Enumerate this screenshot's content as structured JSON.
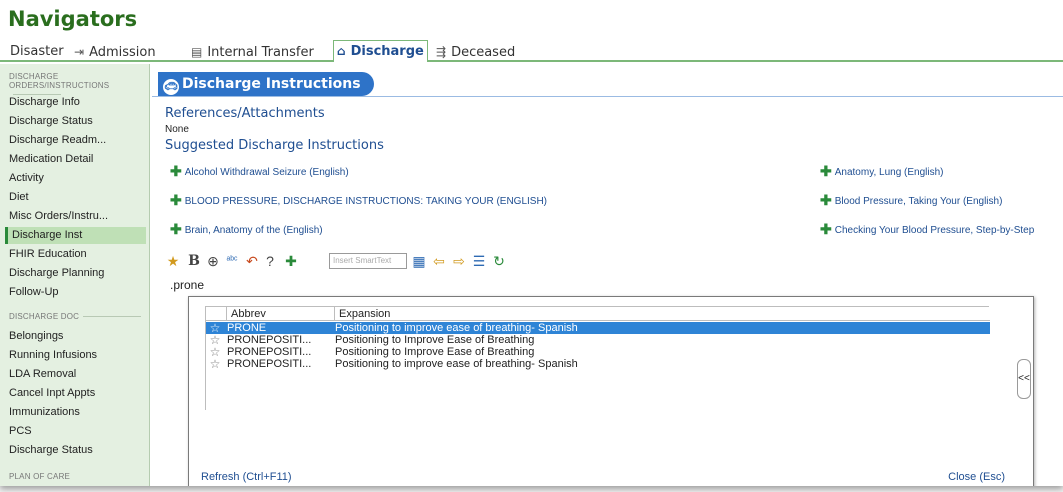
{
  "title": "Navigators",
  "tabs": [
    {
      "label": "Disaster",
      "icon": "exit-icon"
    },
    {
      "label": "Admission",
      "icon": "document-icon"
    },
    {
      "label": "Internal Transfer",
      "icon": "home-icon"
    },
    {
      "label": "Discharge",
      "icon": "deceased-icon",
      "active": true
    },
    {
      "label": "Deceased",
      "icon": ""
    }
  ],
  "sidebar": {
    "section1_header_line1": "Discharge",
    "section1_header_line2": "Orders/Instructions",
    "items1": [
      "Discharge Info",
      "Discharge Status",
      "Discharge Readm...",
      "Medication Detail",
      "Activity",
      "Diet",
      "Misc Orders/Instru...",
      "Discharge Inst",
      "FHIR Education",
      "Discharge Planning",
      "Follow-Up"
    ],
    "selected_item": "Discharge Inst",
    "section2_header": "Discharge Doc",
    "items2": [
      "Belongings",
      "Running Infusions",
      "LDA Removal",
      "Cancel Inpt Appts",
      "Immunizations",
      "PCS",
      "Discharge Status"
    ],
    "section3_header": "Plan of Care"
  },
  "main": {
    "section_title": "Discharge Instructions",
    "references_heading": "References/Attachments",
    "references_value": "None",
    "suggested_heading": "Suggested Discharge Instructions",
    "instructions_left": [
      "Alcohol Withdrawal Seizure (English)",
      "BLOOD PRESSURE, DISCHARGE INSTRUCTIONS: TAKING YOUR (ENGLISH)",
      "Brain, Anatomy of the (English)"
    ],
    "instructions_right": [
      "Anatomy, Lung (English)",
      "Blood Pressure, Taking Your (English)",
      "Checking Your Blood Pressure, Step-by-Step"
    ],
    "smarttext_placeholder": "Insert SmartText",
    "editor_text": ".prone"
  },
  "picker": {
    "col_abbrev": "Abbrev",
    "col_expansion": "Expansion",
    "rows": [
      {
        "abbrev": "PRONE",
        "expansion": "Positioning to improve ease of breathing- Spanish",
        "selected": true
      },
      {
        "abbrev": "PRONEPOSITI...",
        "expansion": "Positioning to Improve Ease of Breathing"
      },
      {
        "abbrev": "PRONEPOSITI...",
        "expansion": "Positioning to Improve Ease of Breathing"
      },
      {
        "abbrev": "PRONEPOSITI...",
        "expansion": "Positioning to improve ease of breathing- Spanish"
      }
    ],
    "refresh_label": "Refresh (Ctrl+F11)",
    "close_label": "Close (Esc)",
    "collapse_label": "<<"
  },
  "colors": {
    "title_green": "#2a6e1e",
    "link_blue": "#1f4e91",
    "pill_blue": "#2e73c8",
    "selected_row_blue": "#2e84d6",
    "sidebar_bg": "#e4f0e1",
    "sidebar_selected": "#bfe0b6",
    "plus_green": "#2a8a3a"
  }
}
